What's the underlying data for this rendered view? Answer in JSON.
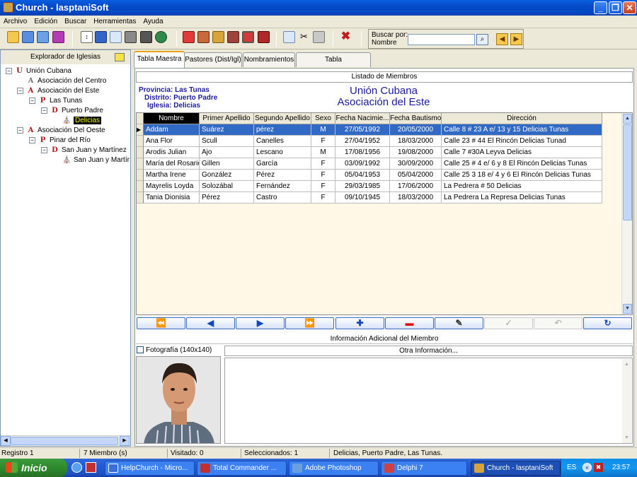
{
  "window": {
    "title": "Church - lasptaniSoft"
  },
  "menu": [
    "Archivo",
    "Edición",
    "Buscar",
    "Herramientas",
    "Ayuda"
  ],
  "search": {
    "label_line1": "Buscar por:",
    "label_line2": "Nombre",
    "value": ""
  },
  "explorer": {
    "title": "Explorador de Iglesias",
    "nodes": [
      {
        "label": "Unión Cubana",
        "icon": "U"
      },
      {
        "label": "Asociación del Centro",
        "icon": "A"
      },
      {
        "label": "Asociación del Este",
        "icon": "A"
      },
      {
        "label": "Las Tunas",
        "icon": "P"
      },
      {
        "label": "Puerto Padre",
        "icon": "D"
      },
      {
        "label": "Delicias",
        "icon": "church"
      },
      {
        "label": "Asociación Del Oeste",
        "icon": "A"
      },
      {
        "label": "Pinar del Río",
        "icon": "P"
      },
      {
        "label": "San Juan y Martínez",
        "icon": "D"
      },
      {
        "label": "San Juan y Martír",
        "icon": "church"
      }
    ]
  },
  "tabs": [
    "Tabla Maestra",
    "Pastores (Dist/Igl)",
    "Nombramientos",
    "Tabla Importar/Exportar"
  ],
  "listing": {
    "header": "Listado de Miembros",
    "provincia_label": "Provincia:",
    "provincia": "Las Tunas",
    "distrito_label": "Distrito:",
    "distrito": "Puerto Padre",
    "iglesia_label": "Iglesia:",
    "iglesia": "Delicias",
    "union": "Unión Cubana",
    "asociacion": "Asociación del Este"
  },
  "grid": {
    "columns": [
      "Nombre",
      "Primer Apellido",
      "Segundo Apellido",
      "Sexo",
      "Fecha Nacimie...",
      "Fecha Bautismo",
      "Dirección"
    ],
    "rows": [
      [
        "Addam",
        "Suárez",
        "pérez",
        "M",
        "27/05/1992",
        "20/05/2000",
        "Calle 8 # 23 A e/ 13 y 15 Delicias Tunas"
      ],
      [
        "Ana Flor",
        "Scull",
        "Canelles",
        "F",
        "27/04/1952",
        "18/03/2000",
        "Calle 23 # 44 El Rincón Delicias Tunad"
      ],
      [
        "Arodis Julian",
        "Ajo",
        "Lescano",
        "M",
        "17/08/1956",
        "19/08/2000",
        "Calle 7 #30A Leyva Delicias"
      ],
      [
        "María del Rosario",
        "Gillen",
        "García",
        "F",
        "03/09/1992",
        "30/09/2000",
        "Calle 25 # 4 e/ 6 y 8 El Rincón Delicias Tunas"
      ],
      [
        "Martha Irene",
        "González",
        "Pérez",
        "F",
        "05/04/1953",
        "05/04/2000",
        "Calle 25 3 18 e/ 4 y 6 El Rincón Delicias Tunas"
      ],
      [
        "Mayrelis Loyda",
        "Solozábal",
        "Fernández",
        "F",
        "29/03/1985",
        "17/06/2000",
        "La Pedrera # 50 Delicias"
      ],
      [
        "Tania Dionisia",
        "Pérez",
        "Castro",
        "F",
        "09/10/1945",
        "18/03/2000",
        "La Pedrera La Represa Delicias Tunas"
      ]
    ]
  },
  "additional": {
    "header": "Información Adicional del Miembro",
    "photo_label": "Fotografía (140x140)",
    "other_label": "Otra Información..."
  },
  "status": {
    "registro": "Registro 1",
    "miembros": "7 Miembro (s)",
    "visitado": "Visitado: 0",
    "seleccionados": "Seleccionados: 1",
    "location": "Delicias, Puerto Padre, Las Tunas."
  },
  "taskbar": {
    "start": "Inicio",
    "tasks": [
      "HelpChurch - Micro...",
      "Total Commander ...",
      "Adobe Photoshop",
      "Delphi 7",
      "Church - lasptaniSoft"
    ],
    "lang": "ES",
    "clock": "23:57"
  },
  "colors": {
    "title_blue": "#0449c8",
    "selection": "#316ac5",
    "grid_bg": "#fff8e7",
    "heading_blue": "#1c1c9c"
  }
}
